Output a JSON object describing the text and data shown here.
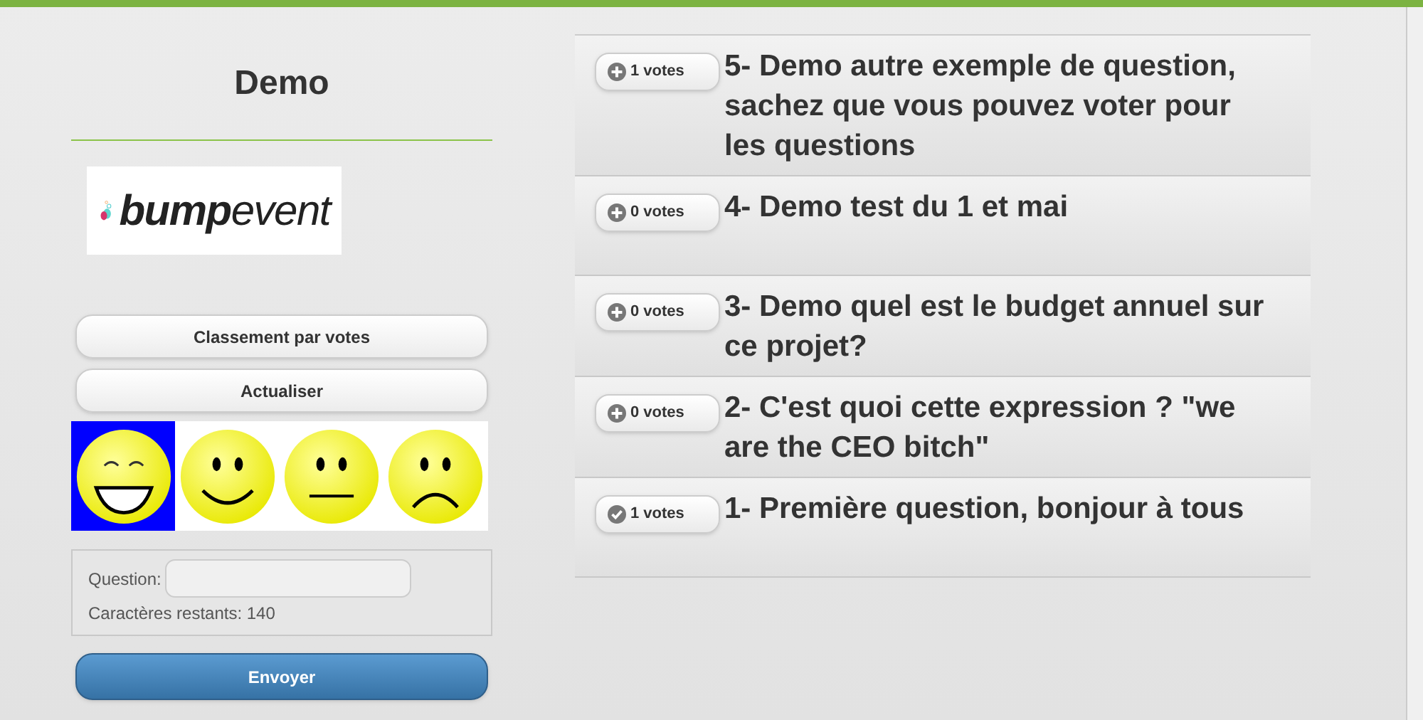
{
  "title": "Demo",
  "logo": {
    "bold": "bump",
    "light": "event"
  },
  "buttons": [
    "Classement par votes",
    "Actualiser"
  ],
  "moods": [
    {
      "kind": "laugh",
      "selected": true
    },
    {
      "kind": "smile",
      "selected": false
    },
    {
      "kind": "neutral",
      "selected": false
    },
    {
      "kind": "sad",
      "selected": false
    }
  ],
  "form": {
    "label": "Question:",
    "remaining": "Caractères restants: 140",
    "submit": "Envoyer"
  },
  "questions": [
    {
      "votes": "1 votes",
      "voted": false,
      "text": "5- Demo autre exemple de question, sachez que vous pouvez voter pour les questions"
    },
    {
      "votes": "0 votes",
      "voted": false,
      "text": "4- Demo test du 1 et mai"
    },
    {
      "votes": "0 votes",
      "voted": false,
      "text": "3- Demo quel est le budget annuel sur ce projet?"
    },
    {
      "votes": "0 votes",
      "voted": false,
      "text": "2- C'est quoi cette expression ? \"we are the CEO bitch\""
    },
    {
      "votes": "1 votes",
      "voted": true,
      "text": "1- Première question, bonjour à tous"
    }
  ]
}
